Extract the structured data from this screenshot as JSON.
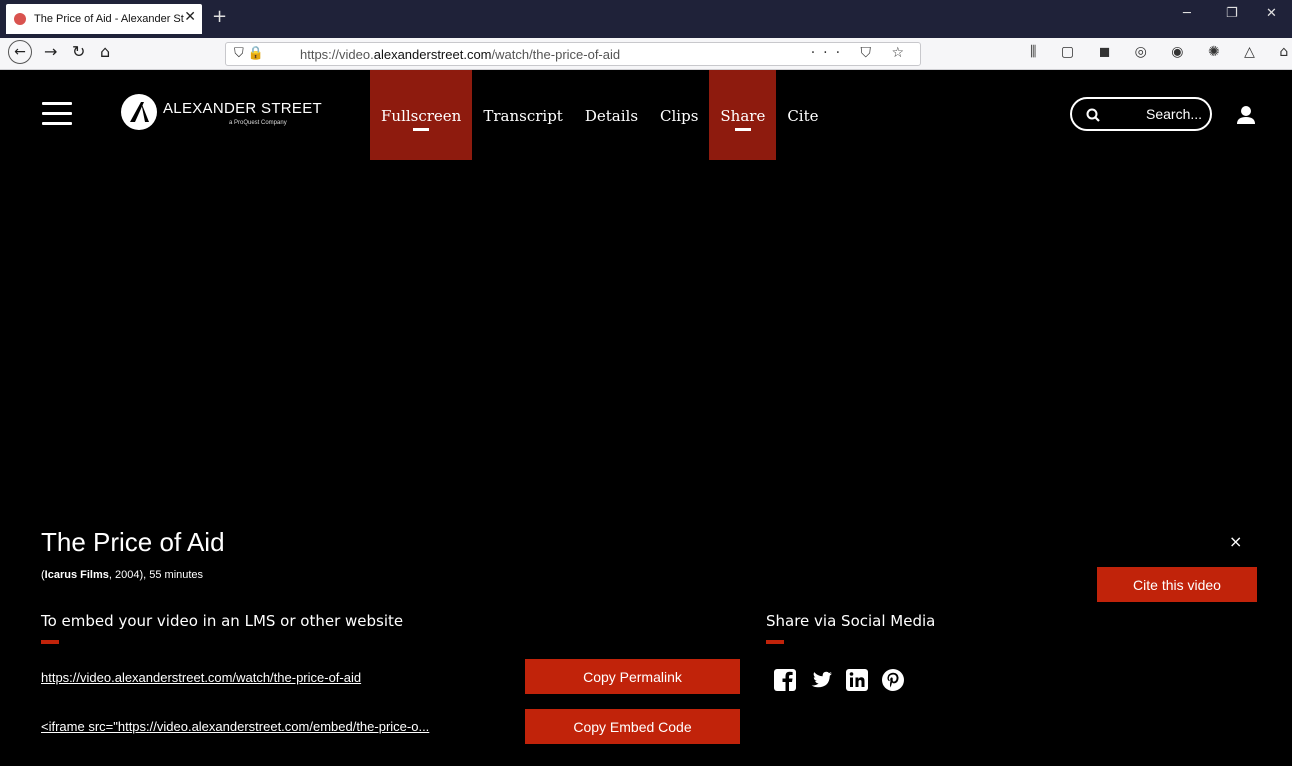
{
  "browser": {
    "tab_title": "The Price of Aid - Alexander Street",
    "tab_close": "✕",
    "new_tab": "+",
    "url_prefix": "https://video.",
    "url_host": "alexanderstreet.com",
    "url_path": "/watch/the-price-of-aid",
    "url_more": "···",
    "minimize": "─",
    "restore": "❐",
    "close": "✕"
  },
  "header": {
    "logo_main": "ALEXANDER STREET",
    "logo_sub": "a ProQuest Company",
    "nav": [
      {
        "label": "Fullscreen",
        "active": true
      },
      {
        "label": "Transcript",
        "active": false
      },
      {
        "label": "Details",
        "active": false
      },
      {
        "label": "Clips",
        "active": false
      },
      {
        "label": "Share",
        "active": true
      },
      {
        "label": "Cite",
        "active": false
      }
    ],
    "search_placeholder": "Search..."
  },
  "video": {
    "title": "The Price of Aid",
    "publisher": "Icarus Films",
    "year_duration": ", 2004), 55 minutes",
    "cite_button": "Cite this video",
    "close_label": "×"
  },
  "embed": {
    "heading": "To embed your video in an LMS or other website",
    "permalink": "https://video.alexanderstreet.com/watch/the-price-of-aid",
    "embed_code": "<iframe src=\"https://video.alexanderstreet.com/embed/the-price-o...",
    "copy_permalink": "Copy Permalink",
    "copy_embed": "Copy Embed Code"
  },
  "social": {
    "heading": "Share via Social Media",
    "icons": [
      "facebook-icon",
      "twitter-icon",
      "linkedin-icon",
      "pinterest-icon"
    ]
  },
  "colors": {
    "accent": "#c1230a",
    "nav_active": "#8e1b0e",
    "chrome": "#1f2239"
  }
}
